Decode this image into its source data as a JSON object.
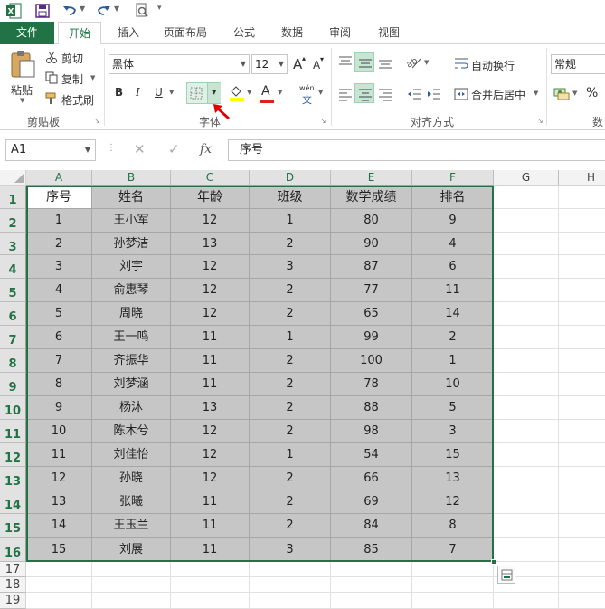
{
  "qat": {
    "icons": [
      "excel-logo-icon",
      "save-icon",
      "undo-icon",
      "redo-icon",
      "print-preview-icon",
      "customize-qat-icon"
    ]
  },
  "tabs": [
    "文件",
    "开始",
    "插入",
    "页面布局",
    "公式",
    "数据",
    "审阅",
    "视图"
  ],
  "ribbon": {
    "clipboard": {
      "paste": "粘贴",
      "cut": "剪切",
      "copy": "复制",
      "format_painter": "格式刷",
      "label": "剪贴板"
    },
    "font": {
      "font_name": "黑体",
      "font_size": "12",
      "bold": "B",
      "italic": "I",
      "underline": "U",
      "grow": "A",
      "shrink": "A",
      "font_color": "A",
      "phonetic": "wén",
      "label": "字体",
      "fill_color": "#ffff00",
      "text_color": "#e02020"
    },
    "alignment": {
      "wrap_text": "自动换行",
      "merge_center": "合并后居中",
      "label": "对齐方式"
    },
    "number": {
      "format": "常规",
      "percent": "%",
      "label": "数"
    }
  },
  "formula_bar": {
    "name_box": "A1",
    "fx": "fx",
    "content": "序号"
  },
  "grid": {
    "columns": [
      "A",
      "B",
      "C",
      "D",
      "E",
      "F",
      "G",
      "H"
    ],
    "rows": [
      "1",
      "2",
      "3",
      "4",
      "5",
      "6",
      "7",
      "8",
      "9",
      "10",
      "11",
      "12",
      "13",
      "14",
      "15",
      "16",
      "17",
      "18",
      "19"
    ],
    "header": [
      "序号",
      "姓名",
      "年龄",
      "班级",
      "数学成绩",
      "排名"
    ],
    "data": [
      [
        "1",
        "王小军",
        "12",
        "1",
        "80",
        "9"
      ],
      [
        "2",
        "孙梦洁",
        "13",
        "2",
        "90",
        "4"
      ],
      [
        "3",
        "刘宇",
        "12",
        "3",
        "87",
        "6"
      ],
      [
        "4",
        "俞惠琴",
        "12",
        "2",
        "77",
        "11"
      ],
      [
        "5",
        "周晓",
        "12",
        "2",
        "65",
        "14"
      ],
      [
        "6",
        "王一鸣",
        "11",
        "1",
        "99",
        "2"
      ],
      [
        "7",
        "齐振华",
        "11",
        "2",
        "100",
        "1"
      ],
      [
        "8",
        "刘梦涵",
        "11",
        "2",
        "78",
        "10"
      ],
      [
        "9",
        "杨沐",
        "13",
        "2",
        "88",
        "5"
      ],
      [
        "10",
        "陈木兮",
        "12",
        "2",
        "98",
        "3"
      ],
      [
        "11",
        "刘佳怡",
        "12",
        "1",
        "54",
        "15"
      ],
      [
        "12",
        "孙晓",
        "12",
        "2",
        "66",
        "13"
      ],
      [
        "13",
        "张曦",
        "11",
        "2",
        "69",
        "12"
      ],
      [
        "14",
        "王玉兰",
        "11",
        "2",
        "84",
        "8"
      ],
      [
        "15",
        "刘展",
        "11",
        "3",
        "85",
        "7"
      ]
    ]
  },
  "colors": {
    "accent": "#217346",
    "selection_fill": "#c6c6c6",
    "arrow": "#e00000"
  }
}
